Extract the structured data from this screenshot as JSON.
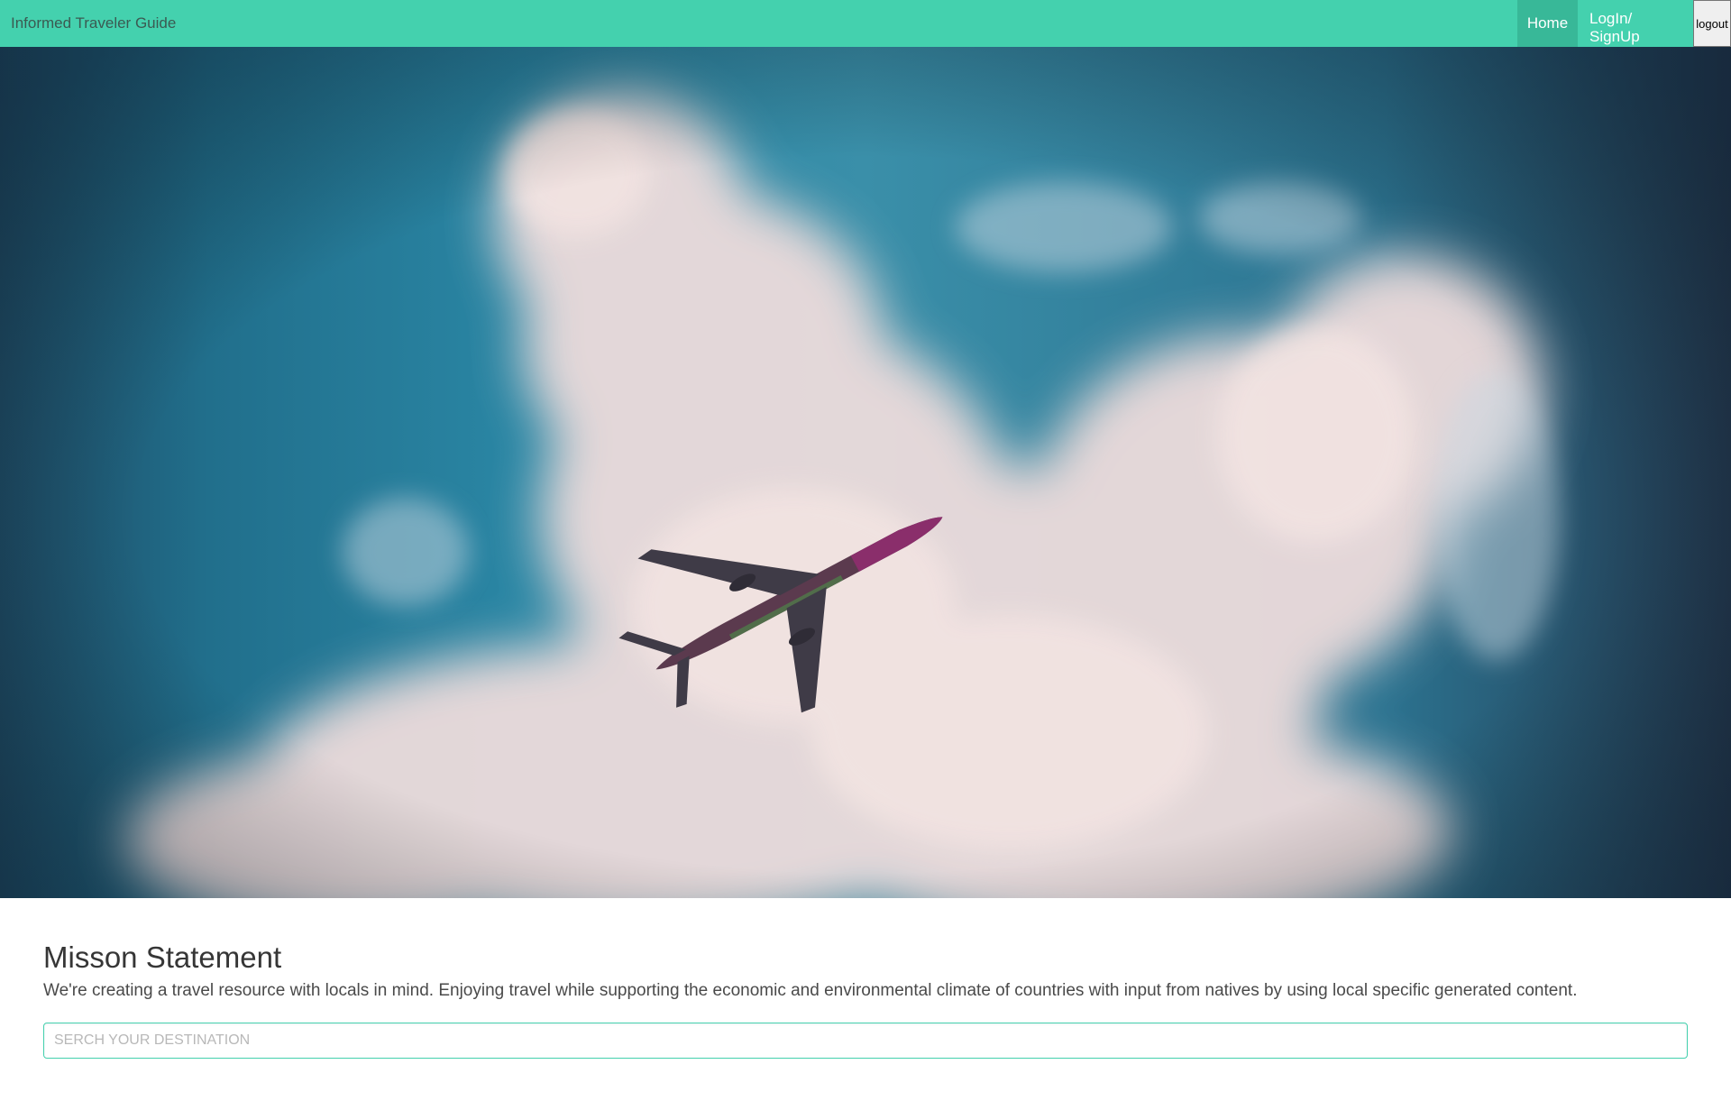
{
  "navbar": {
    "brand": "Informed Traveler Guide",
    "links": [
      {
        "label": "Home",
        "active": true
      },
      {
        "label": "LogIn/ SignUp",
        "active": false
      }
    ],
    "logout_label": "logout",
    "accent_color": "#44d1ae"
  },
  "hero": {
    "image": "airplane-in-cloudy-sky"
  },
  "mission": {
    "title": "Misson Statement",
    "text": "We're creating a travel resource with locals in mind. Enjoying travel while supporting the economic and environmental climate of countries with input from natives by using local specific generated content."
  },
  "search": {
    "placeholder": "SERCH YOUR DESTINATION",
    "value": ""
  }
}
